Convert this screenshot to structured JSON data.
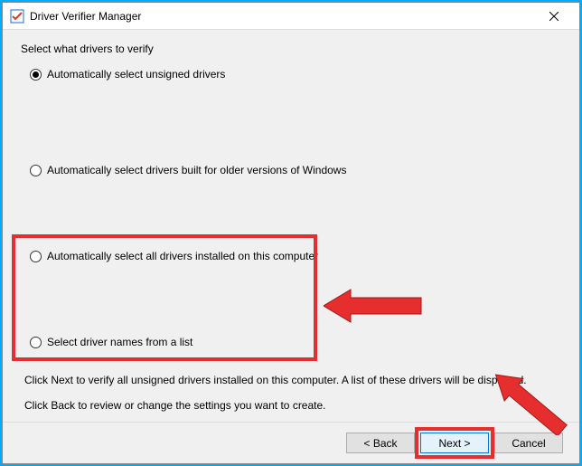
{
  "title": "Driver Verifier Manager",
  "sectionLabel": "Select what drivers to verify",
  "options": {
    "opt1": "Automatically select unsigned drivers",
    "opt2": "Automatically select drivers built for older versions of Windows",
    "opt3": "Automatically select all drivers installed on this computer",
    "opt4": "Select driver names from a list"
  },
  "help": {
    "line1": "Click Next to verify all unsigned drivers installed on this computer. A list of these drivers will be displayed.",
    "line2": "Click Back to review or change the settings you want to create."
  },
  "buttons": {
    "back": "< Back",
    "next": "Next >",
    "cancel": "Cancel"
  }
}
